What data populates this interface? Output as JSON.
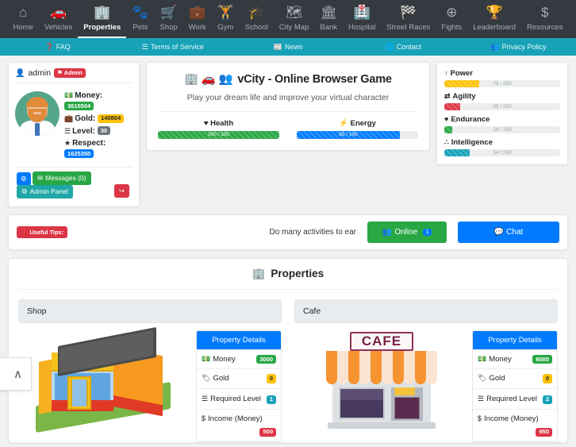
{
  "topnav": {
    "items": [
      {
        "label": "Home",
        "icon": "home-icon",
        "glyph": "⌂",
        "active": false
      },
      {
        "label": "Vehicles",
        "icon": "car-icon",
        "glyph": "🚗",
        "active": false
      },
      {
        "label": "Properties",
        "icon": "building-icon",
        "glyph": "🏢",
        "active": true
      },
      {
        "label": "Pets",
        "icon": "paw-icon",
        "glyph": "🐾",
        "active": false
      },
      {
        "label": "Shop",
        "icon": "cart-icon",
        "glyph": "🛒",
        "active": false
      },
      {
        "label": "Work",
        "icon": "briefcase-icon",
        "glyph": "💼",
        "active": false
      },
      {
        "label": "Gym",
        "icon": "dumbbell-icon",
        "glyph": "🏋",
        "active": false
      },
      {
        "label": "School",
        "icon": "graduation-cap-icon",
        "glyph": "🎓",
        "active": false
      },
      {
        "label": "City Map",
        "icon": "map-icon",
        "glyph": "🗺",
        "active": false
      },
      {
        "label": "Bank",
        "icon": "bank-icon",
        "glyph": "🏛",
        "active": false
      },
      {
        "label": "Hospital",
        "icon": "hospital-icon",
        "glyph": "🏥",
        "active": false
      },
      {
        "label": "Street Races",
        "icon": "checkered-flag-icon",
        "glyph": "🏁",
        "active": false
      },
      {
        "label": "Fights",
        "icon": "crosshair-icon",
        "glyph": "⊕",
        "active": false
      },
      {
        "label": "Leaderboard",
        "icon": "trophy-icon",
        "glyph": "🏆",
        "active": false
      },
      {
        "label": "Resources",
        "icon": "dollar-icon",
        "glyph": "$",
        "active": false
      }
    ]
  },
  "subnav": {
    "items": [
      {
        "label": "FAQ",
        "icon": "question-circle-icon",
        "glyph": "❓"
      },
      {
        "label": "Terms of Service",
        "icon": "list-icon",
        "glyph": "☰"
      },
      {
        "label": "News",
        "icon": "newspaper-icon",
        "glyph": "📰"
      },
      {
        "label": "Contact",
        "icon": "globe-icon",
        "glyph": "🌐"
      },
      {
        "label": "Privacy Policy",
        "icon": "user-shield-icon",
        "glyph": "👥"
      }
    ]
  },
  "user": {
    "username": "admin",
    "role_badge": "Admin",
    "money_label": "Money:",
    "money_value": "3615504",
    "gold_label": "Gold:",
    "gold_value": "140804",
    "level_label": "Level:",
    "level_value": "30",
    "respect_label": "Respect:",
    "respect_value": "1625350",
    "settings_glyph": "⚙",
    "messages_label": "Messages (0)",
    "messages_glyph": "✉",
    "admin_panel_label": "Admin Panel",
    "admin_panel_glyph": "⚙",
    "logout_glyph": "↪"
  },
  "center": {
    "title": "vCity - Online Browser Game",
    "title_icons": "🏢 🚗 👥",
    "subtitle": "Play your dream life and improve your virtual character",
    "bars": [
      {
        "label": "Health",
        "icon": "heart-icon",
        "glyph": "♥",
        "value": 100,
        "max": 100,
        "text": "100 / 100",
        "color": "#28a745",
        "fill_class": "f-green"
      },
      {
        "label": "Energy",
        "icon": "bolt-icon",
        "glyph": "⚡",
        "value": 85,
        "max": 100,
        "text": "85 / 100",
        "color": "#007bff",
        "fill_class": "f-blue"
      }
    ]
  },
  "attributes": [
    {
      "label": "Power",
      "icon": "power-icon",
      "glyph": "↑",
      "value": 75,
      "max": 250,
      "text": "75 / 250",
      "color": "#ffc107",
      "fill_class": "f-yellow"
    },
    {
      "label": "Agility",
      "icon": "exchange-icon",
      "glyph": "⇄",
      "value": 35,
      "max": 250,
      "text": "35 / 250",
      "color": "#dc3545",
      "fill_class": "f-red"
    },
    {
      "label": "Endurance",
      "icon": "heartbeat-icon",
      "glyph": "♥",
      "value": 18,
      "max": 250,
      "text": "18 / 250",
      "color": "#28a745",
      "fill_class": "f-green"
    },
    {
      "label": "Intelligence",
      "icon": "brain-icon",
      "glyph": "∴",
      "value": 54,
      "max": 250,
      "text": "54 / 250",
      "color": "#17a2b8",
      "fill_class": "f-cyan"
    }
  ],
  "tips": {
    "badge": "Useful Tips:",
    "badge_glyph": "❗",
    "text": "Do many activities to ear",
    "online_label": "Online",
    "online_glyph": "👥",
    "online_count": "1",
    "chat_label": "Chat",
    "chat_glyph": "💬"
  },
  "properties": {
    "section_title": "Properties",
    "section_glyph": "🏢",
    "details_header": "Property Details",
    "items": [
      {
        "name": "Shop",
        "image": "shop-illustration",
        "rows": [
          {
            "label": "Money",
            "icon": "money-bill-icon",
            "glyph": "💵",
            "value": "3000",
            "badge": "badge-green"
          },
          {
            "label": "Gold",
            "icon": "gold-bar-icon",
            "glyph": "🏷",
            "value": "0",
            "badge": "badge-yellow"
          },
          {
            "label": "Required Level",
            "icon": "list-icon",
            "glyph": "☰",
            "value": "1",
            "badge": "badge-cyan"
          },
          {
            "label": "Income (Money)",
            "icon": "dollar-icon",
            "glyph": "$",
            "value": "500",
            "badge": "badge-red"
          }
        ]
      },
      {
        "name": "Cafe",
        "image": "cafe-illustration",
        "rows": [
          {
            "label": "Money",
            "icon": "money-bill-icon",
            "glyph": "💵",
            "value": "6000",
            "badge": "badge-green"
          },
          {
            "label": "Gold",
            "icon": "gold-bar-icon",
            "glyph": "🏷",
            "value": "0",
            "badge": "badge-yellow"
          },
          {
            "label": "Required Level",
            "icon": "list-icon",
            "glyph": "☰",
            "value": "2",
            "badge": "badge-cyan"
          },
          {
            "label": "Income (Money)",
            "icon": "dollar-icon",
            "glyph": "$",
            "value": "950",
            "badge": "badge-red"
          }
        ]
      }
    ]
  },
  "scroll_top": {
    "glyph": "∧"
  },
  "colors": {
    "nav_bg": "#343a40",
    "subnav_bg": "#17a2b8",
    "primary": "#007bff",
    "success": "#28a745",
    "danger": "#dc3545",
    "warning": "#ffc107",
    "info": "#17a2b8",
    "page_bg": "#f1f1f1"
  }
}
